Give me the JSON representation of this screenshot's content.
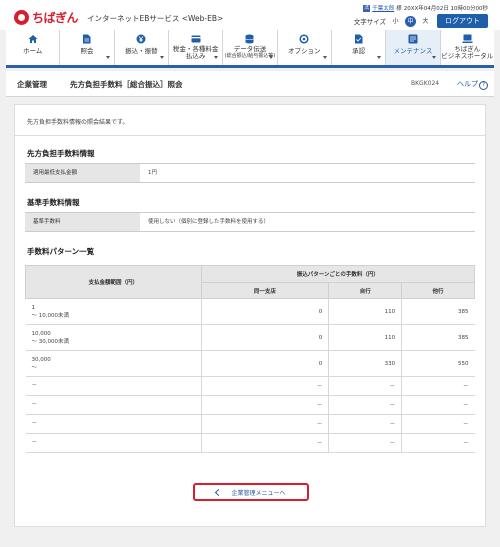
{
  "header": {
    "logo_text": "ちばぎん",
    "service_name": "インターネットEBサービス <Web-EB>",
    "user_icon": "法",
    "user_name": "千葉太郎",
    "user_suffix": "様",
    "last_login": "20XX年04月02日 10時00分00秒",
    "text_size_label": "文字サイズ",
    "size_small": "小",
    "size_medium": "中",
    "size_large": "大",
    "logout_label": "ログアウト"
  },
  "nav": {
    "items": [
      {
        "label": "ホーム",
        "icon": "home-icon"
      },
      {
        "label": "照会",
        "icon": "document-icon"
      },
      {
        "label": "振込・振替",
        "icon": "yen-transfer-icon"
      },
      {
        "label_1": "税金・各種料金",
        "label_2": "払込み",
        "icon": "tax-payment-icon"
      },
      {
        "label_1": "データ伝送",
        "label_2": "(総合振込/給与振込等)",
        "icon": "database-icon"
      },
      {
        "label": "オプション",
        "icon": "options-icon"
      },
      {
        "label": "承認",
        "icon": "approval-icon"
      },
      {
        "label": "メンテナンス",
        "icon": "maintenance-icon"
      },
      {
        "label_1": "ちばぎん",
        "label_2": "ビジネスポータル",
        "icon": "portal-icon"
      }
    ]
  },
  "titlebar": {
    "category": "企業管理",
    "title": "先方負担手数料［総合振込］照会",
    "screen_code": "BKGK024",
    "help_label": "ヘルプ"
  },
  "main": {
    "intro": "先方負担手数料情報の照会結果です。",
    "section1": {
      "title": "先方負担手数料情報",
      "key": "適用最低支払金額",
      "value": "1円"
    },
    "section2": {
      "title": "基準手数料情報",
      "key": "基準手数料",
      "value": "使用しない（個別に登録した手数料を使用する）"
    },
    "section3": {
      "title": "手数料パターン一覧",
      "col_range": "支払金額範囲（円）",
      "col_group": "振込パターンごとの手数料（円）",
      "col_same_branch": "同一支店",
      "col_own_bank": "自行",
      "col_other_bank": "他行",
      "rows": [
        {
          "r1": "1",
          "r2": "～ 10,000未満",
          "same": "0",
          "own": "110",
          "other": "385"
        },
        {
          "r1": "10,000",
          "r2": "～ 30,000未満",
          "same": "0",
          "own": "110",
          "other": "385"
        },
        {
          "r1": "30,000",
          "r2": "～",
          "same": "0",
          "own": "330",
          "other": "550"
        },
        {
          "r1": "－",
          "r2": "",
          "same": "－",
          "own": "－",
          "other": "－"
        },
        {
          "r1": "－",
          "r2": "",
          "same": "－",
          "own": "－",
          "other": "－"
        },
        {
          "r1": "－",
          "r2": "",
          "same": "－",
          "own": "－",
          "other": "－"
        },
        {
          "r1": "－",
          "r2": "",
          "same": "－",
          "own": "－",
          "other": "－"
        }
      ]
    },
    "back_button_label": "企業管理メニューへ"
  },
  "colors": {
    "brand_red": "#d81e2c",
    "accent_blue": "#2a5fb0",
    "header_gray": "#e6e6e6"
  }
}
